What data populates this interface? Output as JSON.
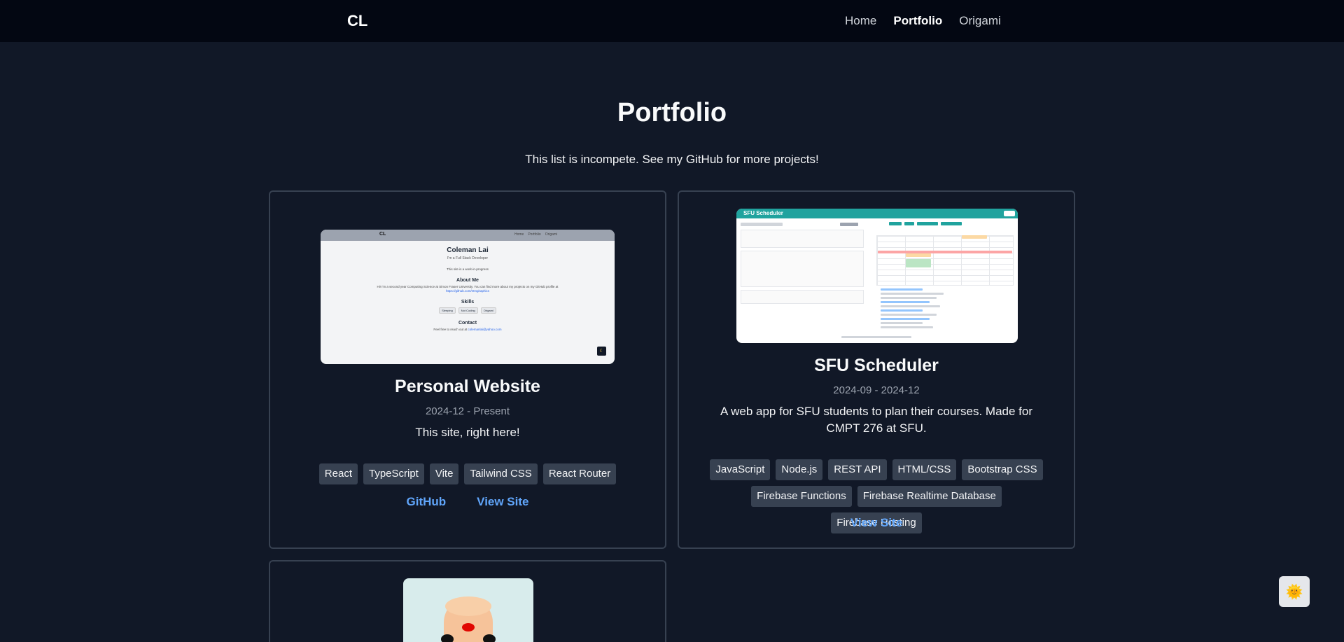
{
  "nav": {
    "logo": "CL",
    "links": [
      "Home",
      "Portfolio",
      "Origami"
    ],
    "active": "Portfolio"
  },
  "page": {
    "title": "Portfolio",
    "subtitle": "This list is incompete. See my GitHub for more projects!"
  },
  "projects": [
    {
      "title": "Personal Website",
      "date": "2024-12 - Present",
      "description": "This site, right here!",
      "tags": [
        "React",
        "TypeScript",
        "Vite",
        "Tailwind CSS",
        "React Router"
      ],
      "links": [
        "GitHub",
        "View Site"
      ],
      "preview": {
        "logo": "CL",
        "nav": [
          "Home",
          "Portfolio",
          "Origami"
        ],
        "name": "Coleman Lai",
        "role": "I'm a Full Stack Developer",
        "wip": "This site is a work-in-progress",
        "about_heading": "About Me",
        "about_text": "Hi! I'm a second year Computing Science at Simon Fraser University. You can find more about my projects on my GitHub profile at",
        "about_link": "https://github.com/Omgiraphics",
        "skills_heading": "Skills",
        "skills": [
          "Sleeping",
          "Not Coding",
          "Origami"
        ],
        "contact_heading": "Contact",
        "contact_text": "Feel free to reach out at",
        "contact_email": "colemanlai@yahoo.com"
      }
    },
    {
      "title": "SFU Scheduler",
      "date": "2024-09 - 2024-12",
      "description": "A web app for SFU students to plan their courses. Made for CMPT 276 at SFU.",
      "tags": [
        "JavaScript",
        "Node.js",
        "REST API",
        "HTML/CSS",
        "Bootstrap CSS",
        "Firebase Functions",
        "Firebase Realtime Database",
        "Firebase Hosting"
      ],
      "links": [
        "View Site"
      ],
      "preview": {
        "app_title": "SFU Scheduler"
      }
    },
    {
      "preview": {}
    }
  ],
  "theme_toggle_icon": "sun-face-icon",
  "colors": {
    "background": "#111827",
    "navbar": "#030712",
    "card_border": "#374151",
    "tag_bg": "#374151",
    "link": "#60a5fa",
    "muted": "#9ca3af"
  }
}
